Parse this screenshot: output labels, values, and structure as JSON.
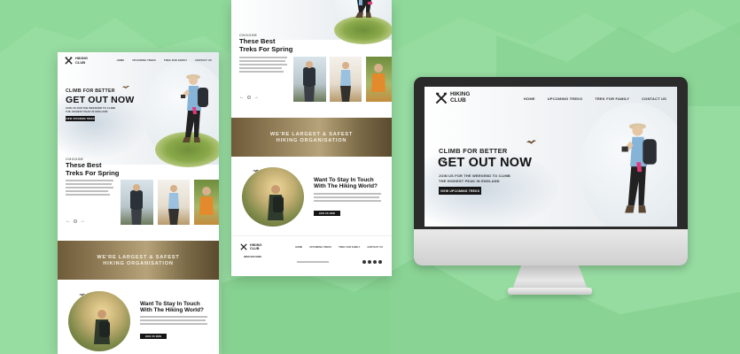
{
  "brand": {
    "line1": "HIKING",
    "line2": "CLUB"
  },
  "nav": [
    "HOME",
    "UPCOMING TREKS",
    "TREK FOR FAMILY",
    "CONTACT US"
  ],
  "hero": {
    "tagline": "CLIMB FOR BETTER",
    "headline": "GET OUT NOW",
    "subline1": "JOIN US FOR THE WEEKEND TO CLIMB",
    "subline2": "THE HIGHEST PEAK IN ENGLAND",
    "button": "VIEW UPCOMING TREKS"
  },
  "treks": {
    "kicker": "CHOOSE",
    "title1": "These Best",
    "title2": "Treks For Spring"
  },
  "banner": {
    "line1": "WE'RE LARGEST & SAFEST",
    "line2": "HIKING ORGANISATION"
  },
  "contact": {
    "title1": "Want To Stay In Touch",
    "title2": "With The Hiking World?",
    "button": "JOIN US NOW"
  },
  "footer": {
    "phone": "0000 000 0000"
  },
  "colors": {
    "background": "#8fd99a",
    "dark": "#161616",
    "frame": "#2b2b2b"
  }
}
